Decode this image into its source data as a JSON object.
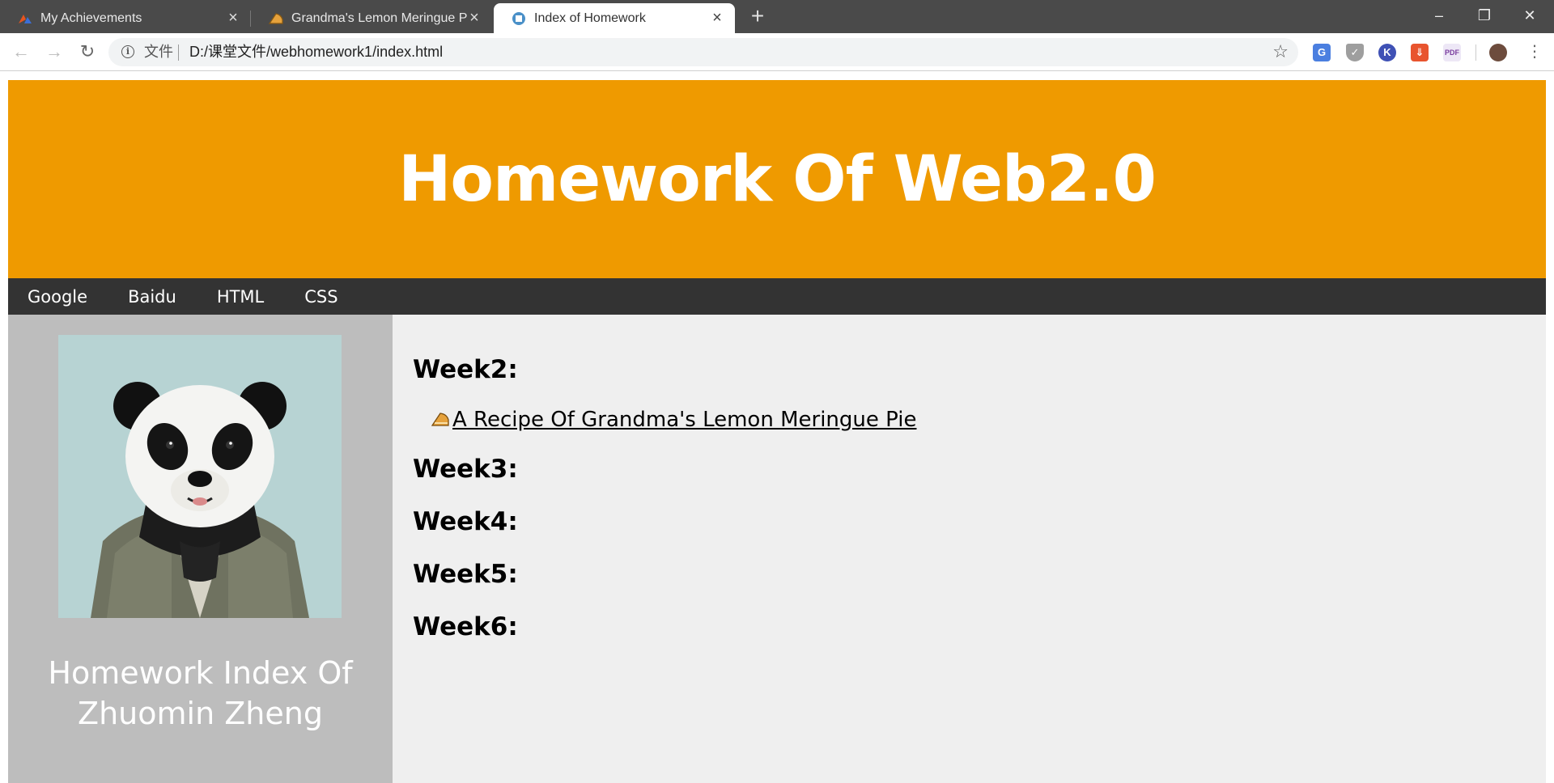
{
  "browser": {
    "tabs": [
      {
        "title": "My Achievements",
        "icon": "achievements-logo-icon",
        "active": false
      },
      {
        "title": "Grandma's Lemon Meringue P",
        "icon": "pie-icon",
        "active": false
      },
      {
        "title": "Index of Homework",
        "icon": "page-icon",
        "active": true
      }
    ],
    "address": {
      "scheme_label": "文件",
      "url": "D:/课堂文件/webhomework1/index.html"
    },
    "window_controls": {
      "minimize": "–",
      "restore": "❐",
      "close": "✕"
    },
    "extensions": [
      "translate-icon",
      "shield-icon",
      "k-extension-icon",
      "download-extension-icon",
      "pdf-icon",
      "profile-avatar-icon"
    ]
  },
  "page": {
    "banner_title": "Homework Of Web2.0",
    "nav": [
      {
        "label": "Google"
      },
      {
        "label": "Baidu"
      },
      {
        "label": "HTML"
      },
      {
        "label": "CSS"
      }
    ],
    "sidebar": {
      "caption_line1": "Homework Index Of",
      "caption_line2": "Zhuomin Zheng"
    },
    "weeks": [
      {
        "label": "Week2:"
      },
      {
        "label": "Week3:"
      },
      {
        "label": "Week4:"
      },
      {
        "label": "Week5:"
      },
      {
        "label": "Week6:"
      }
    ],
    "week2_link": "A Recipe Of Grandma's Lemon Meringue Pie",
    "colors": {
      "banner": "#ef9a00",
      "nav": "#333333",
      "sidebar": "#bdbdbd",
      "main": "#efefef"
    }
  }
}
